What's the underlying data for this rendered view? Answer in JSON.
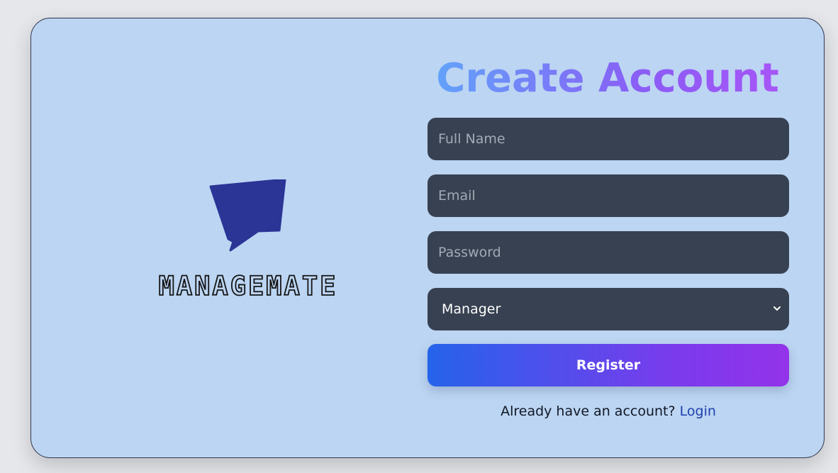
{
  "brand": {
    "name": "MANAGEMATE",
    "logo_icon": "speech-bubble-icon",
    "logo_color": "#2b3596"
  },
  "form": {
    "title": "Create Account",
    "full_name_placeholder": "Full Name",
    "email_placeholder": "Email",
    "password_placeholder": "Password",
    "role_selected": "Manager",
    "register_label": "Register",
    "already_text": "Already have an account?",
    "login_link": "Login"
  },
  "colors": {
    "card_bg": "#bcd5f2",
    "field_bg": "#374151",
    "button_gradient_start": "#2563eb",
    "button_gradient_end": "#9333ea",
    "link": "#1e40af"
  }
}
